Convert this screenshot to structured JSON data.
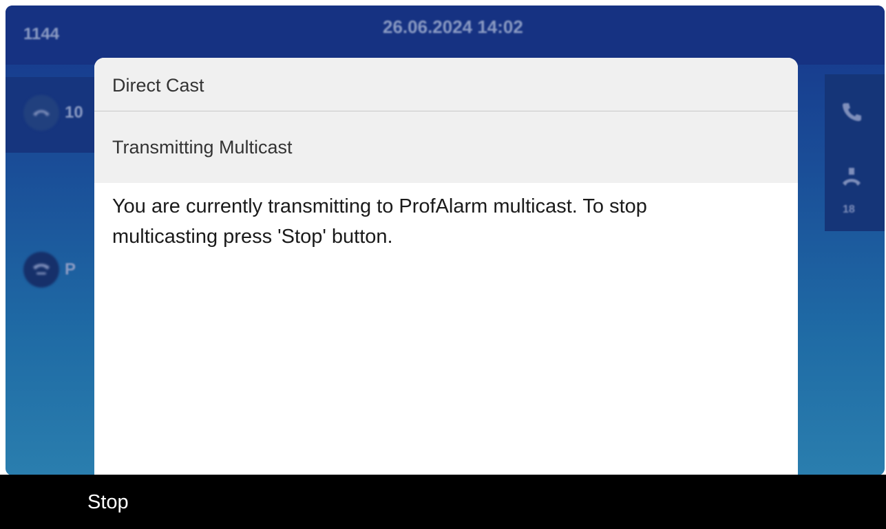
{
  "status_bar": {
    "extension": "1144",
    "datetime": "26.06.2024 14:02"
  },
  "lines": {
    "active_label": "10",
    "other_label": "P"
  },
  "right_panel": {
    "icons": [
      "phone-icon",
      "call-pickup-icon"
    ],
    "pickup_count": "18"
  },
  "dialog": {
    "title": "Direct Cast",
    "subtitle": "Transmitting Multicast",
    "message": "You are currently transmitting to ProfAlarm multicast. To stop multicasting press 'Stop' button."
  },
  "softkeys": {
    "stop_label": "Stop"
  },
  "colors": {
    "background_top": "#16358a",
    "background_bottom": "#2a7eae",
    "dialog_header": "#f0f0f0",
    "softkey_bar": "#000000"
  }
}
